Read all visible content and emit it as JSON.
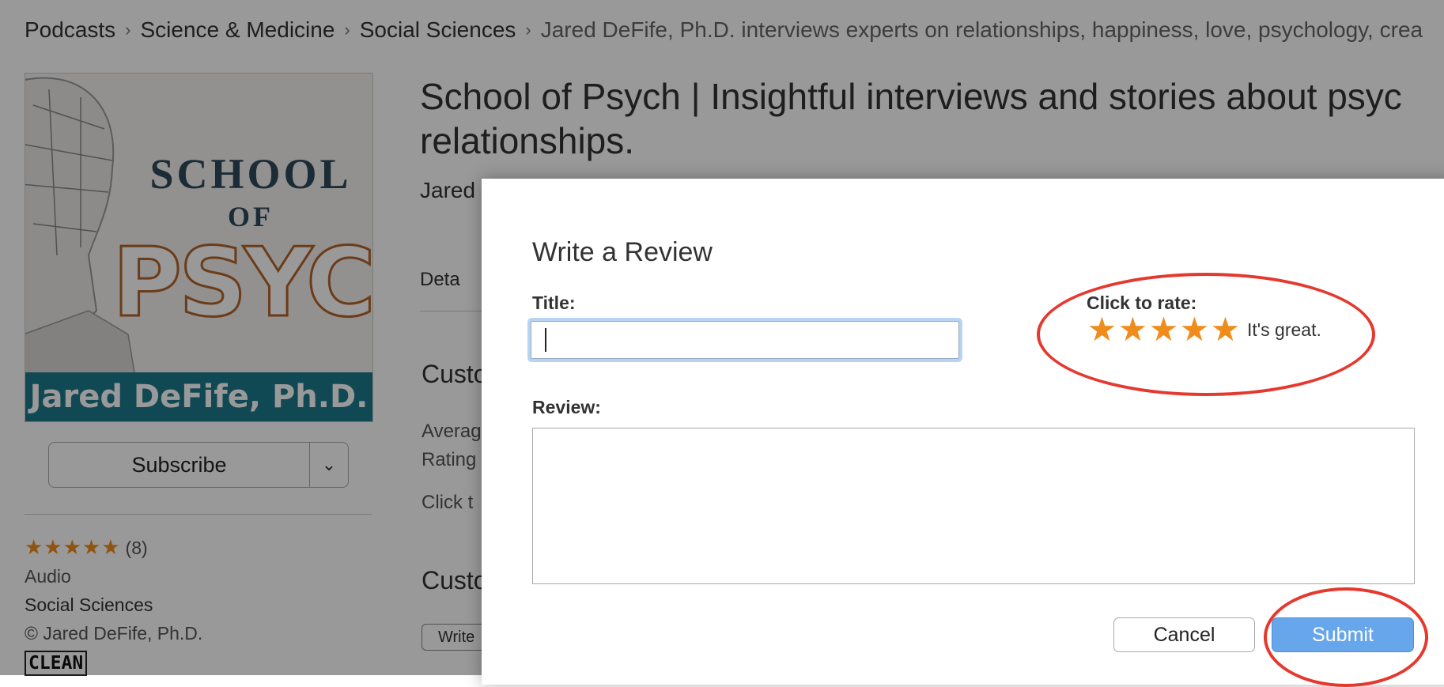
{
  "breadcrumb": {
    "items": [
      "Podcasts",
      "Science & Medicine",
      "Social Sciences",
      "Jared DeFife, Ph.D. interviews experts on relationships, happiness, love, psychology, crea"
    ]
  },
  "artwork": {
    "school": "SCHOOL",
    "of": "OF",
    "psych": "PSYCH",
    "author": "Jared DeFife, Ph.D."
  },
  "sidebar": {
    "subscribe_label": "Subscribe",
    "stars": "★★★★★",
    "rating_count": "(8)",
    "media_type": "Audio",
    "category": "Social Sciences",
    "copyright": "© Jared DeFife, Ph.D.",
    "explicit_badge": "CLEAN"
  },
  "main": {
    "title": "School of Psych | Insightful interviews and stories about psyc",
    "title_line2": "relationships.",
    "author": "Jared",
    "tab_details": "Deta",
    "section1": "Custo",
    "avg_line1": "Averag",
    "avg_line2": "Rating",
    "click_to": "Click t",
    "section2": "Custo",
    "write_btn": "Write"
  },
  "modal": {
    "title": "Write a Review",
    "title_label": "Title:",
    "title_value": "",
    "rate_label": "Click to rate:",
    "rating": 5,
    "rating_text": "It's great.",
    "review_label": "Review:",
    "review_value": "",
    "cancel_label": "Cancel",
    "submit_label": "Submit"
  },
  "colors": {
    "star": "#f08c1b",
    "submit_bg": "#67a6ea",
    "annotation_ring": "#e5382f",
    "art_band": "#1c7b8c"
  }
}
